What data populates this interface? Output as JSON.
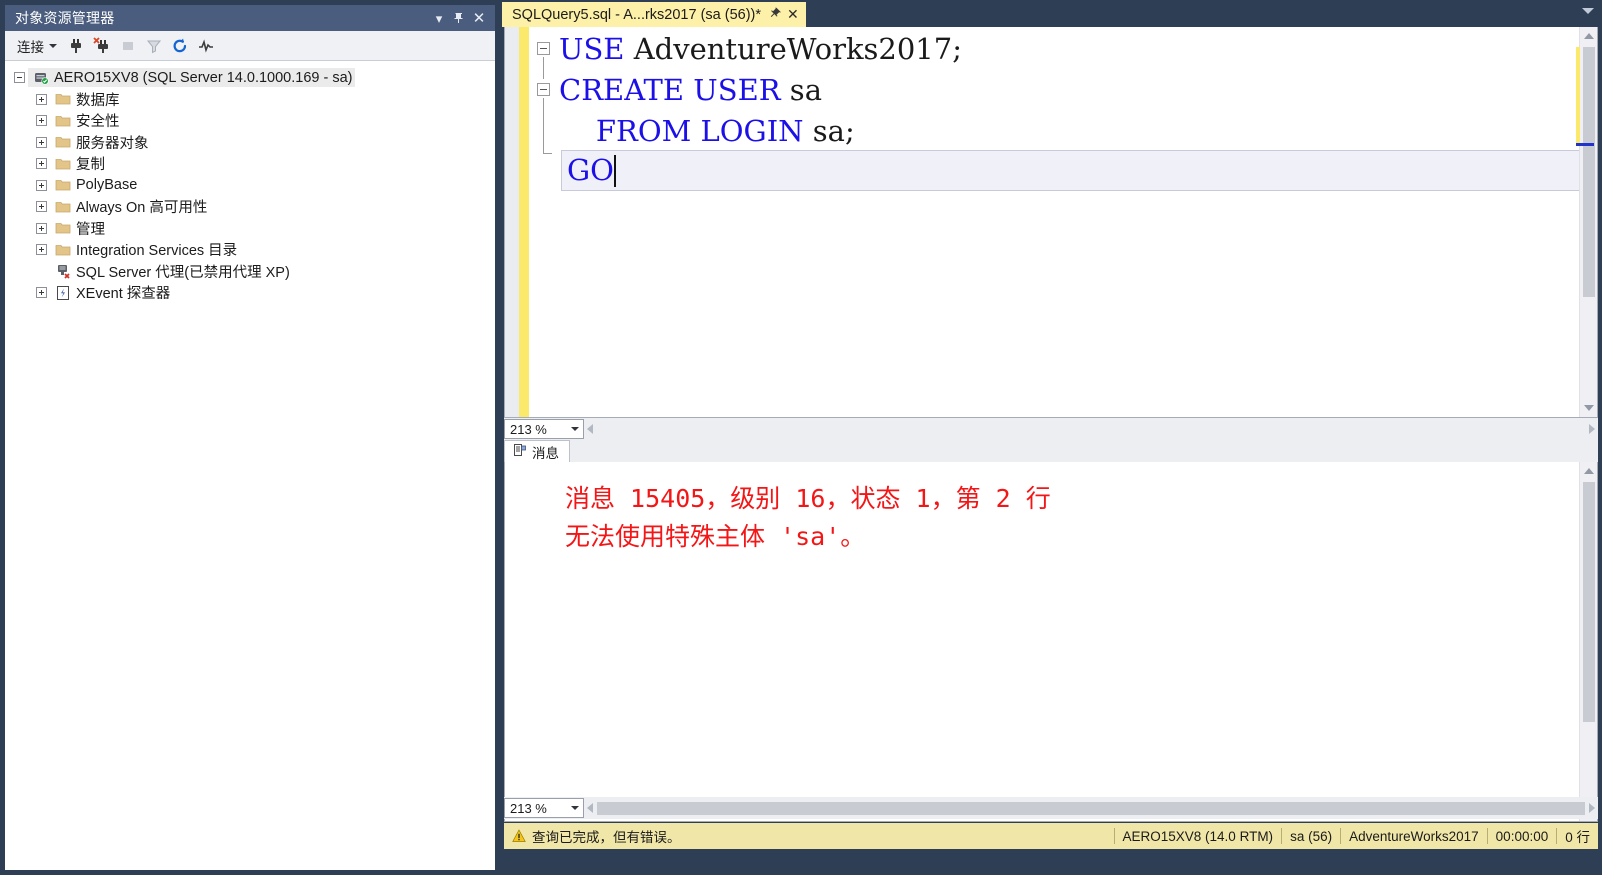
{
  "object_explorer": {
    "title": "对象资源管理器",
    "title_buttons": [
      {
        "name": "window-dropdown-button",
        "glyph": "▾"
      },
      {
        "name": "auto-hide-pin-button",
        "glyph": "⇱"
      },
      {
        "name": "close-panel-button",
        "glyph": "✕"
      }
    ],
    "toolbar": {
      "connect_label": "连接",
      "icons": [
        "connect-plug-icon",
        "disconnect-plug-icon",
        "stop-icon",
        "filter-funnel-icon",
        "refresh-icon",
        "activity-monitor-icon"
      ]
    },
    "tree": {
      "root": {
        "label": "AERO15XV8 (SQL Server 14.0.1000.169 - sa)",
        "icon": "server-icon",
        "expanded": true,
        "selected": true
      },
      "children": [
        {
          "label": "数据库",
          "icon": "folder-icon",
          "expandable": true
        },
        {
          "label": "安全性",
          "icon": "folder-icon",
          "expandable": true
        },
        {
          "label": "服务器对象",
          "icon": "folder-icon",
          "expandable": true
        },
        {
          "label": "复制",
          "icon": "folder-icon",
          "expandable": true
        },
        {
          "label": "PolyBase",
          "icon": "folder-icon",
          "expandable": true
        },
        {
          "label": "Always On 高可用性",
          "icon": "folder-icon",
          "expandable": true
        },
        {
          "label": "管理",
          "icon": "folder-icon",
          "expandable": true
        },
        {
          "label": "Integration Services 目录",
          "icon": "folder-icon",
          "expandable": true
        },
        {
          "label": "SQL Server 代理(已禁用代理 XP)",
          "icon": "sql-agent-disabled-icon",
          "expandable": false
        },
        {
          "label": "XEvent 探查器",
          "icon": "xevent-profiler-icon",
          "expandable": true
        }
      ]
    }
  },
  "editor": {
    "tab": {
      "label": "SQLQuery5.sql - A...rks2017 (sa (56))*",
      "pin_glyph": "⇱",
      "close_glyph": "✕"
    },
    "code_lines": [
      {
        "fold": "start",
        "segments": [
          {
            "t": "USE",
            "k": true
          },
          {
            "t": " AdventureWorks2017",
            "k": false
          },
          {
            "t": ";",
            "k": false
          }
        ]
      },
      {
        "fold": "start",
        "segments": [
          {
            "t": "CREATE USER",
            "k": true
          },
          {
            "t": " sa",
            "k": false
          }
        ]
      },
      {
        "fold": "mid",
        "segments": [
          {
            "t": "    ",
            "k": false
          },
          {
            "t": "FROM LOGIN",
            "k": true
          },
          {
            "t": " sa",
            "k": false
          },
          {
            "t": ";",
            "k": false
          }
        ]
      }
    ],
    "current_line": {
      "text": "GO",
      "keyword": true
    },
    "zoom_level": "213 %"
  },
  "results": {
    "tab_label": "消息",
    "tab_icon": "messages-icon",
    "message_lines": [
      "消息 15405，级别 16，状态 1，第 2 行",
      "无法使用特殊主体 'sa'。"
    ],
    "message_color": "#f41616",
    "zoom_level": "213 %"
  },
  "status_bar": {
    "icon": "warning-icon",
    "message": "查询已完成，但有错误。",
    "segments": [
      "AERO15XV8 (14.0 RTM)",
      "sa (56)",
      "AdventureWorks2017",
      "00:00:00",
      "0 行"
    ]
  },
  "theme": {
    "window_chrome": "#2d3e55",
    "panel_header": "#4a5d7e",
    "tab_active": "#fdf0a8",
    "status_bar": "#f0e6a8",
    "keyword": "#1c10e8",
    "error_text": "#f41616",
    "change_bar": "#fbe96b"
  }
}
